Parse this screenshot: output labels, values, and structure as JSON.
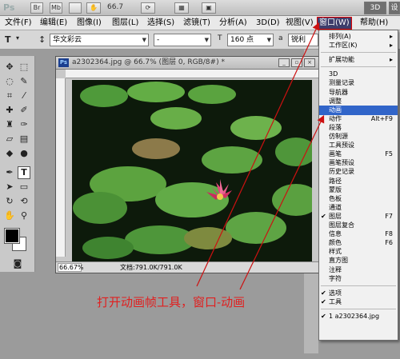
{
  "appbar": {
    "logo": "Ps",
    "btn_br": "Br",
    "btn_mb": "Mb",
    "zoom": "66.7",
    "btn_3d": "3D",
    "btn_settings": "设"
  },
  "menubar": {
    "items": [
      "文件(F)",
      "编辑(E)",
      "图像(I)",
      "图层(L)",
      "选择(S)",
      "滤镜(T)",
      "分析(A)",
      "3D(D)",
      "视图(V)",
      "窗口(W)",
      "帮助(H)"
    ]
  },
  "options": {
    "tool_glyph": "T",
    "font_family": "华文彩云",
    "font_style": "-",
    "font_size": "160 点",
    "aa_label": "a",
    "antialias": "锐利"
  },
  "document": {
    "ps_badge": "Ps",
    "title": "a2302364.jpg @ 66.7% (图层 0, RGB/8#) *",
    "zoom": "66.67%",
    "info": "文档:791.0K/791.0K"
  },
  "dropdown": {
    "items": [
      {
        "label": "排列(A)",
        "sub": true
      },
      {
        "label": "工作区(K)",
        "sub": true
      },
      {
        "sep": true
      },
      {
        "label": "扩展功能",
        "sub": true
      },
      {
        "sep": true
      },
      {
        "label": "3D"
      },
      {
        "label": "测量记录"
      },
      {
        "label": "导航器"
      },
      {
        "label": "调整"
      },
      {
        "label": "动画",
        "highlight": true
      },
      {
        "label": "动作",
        "shortcut": "Alt+F9"
      },
      {
        "label": "段落"
      },
      {
        "label": "仿制源"
      },
      {
        "label": "工具预设"
      },
      {
        "label": "画笔",
        "shortcut": "F5"
      },
      {
        "label": "画笔预设"
      },
      {
        "label": "历史记录"
      },
      {
        "label": "路径"
      },
      {
        "label": "蒙版"
      },
      {
        "label": "色板"
      },
      {
        "label": "通道"
      },
      {
        "label": "图层",
        "shortcut": "F7",
        "checked": true
      },
      {
        "label": "图层复合"
      },
      {
        "label": "信息",
        "shortcut": "F8"
      },
      {
        "label": "颜色",
        "shortcut": "F6"
      },
      {
        "label": "样式"
      },
      {
        "label": "直方图"
      },
      {
        "label": "注释"
      },
      {
        "label": "字符"
      },
      {
        "sep": true
      },
      {
        "label": "选项",
        "checked": true
      },
      {
        "label": "工具",
        "checked": true
      },
      {
        "sep": true
      },
      {
        "label": "1 a2302364.jpg",
        "checked": true
      }
    ]
  },
  "annotation": "打开动画帧工具，窗口-动画",
  "colors": {
    "highlight": "#3165c9",
    "annotation": "#e02020"
  }
}
